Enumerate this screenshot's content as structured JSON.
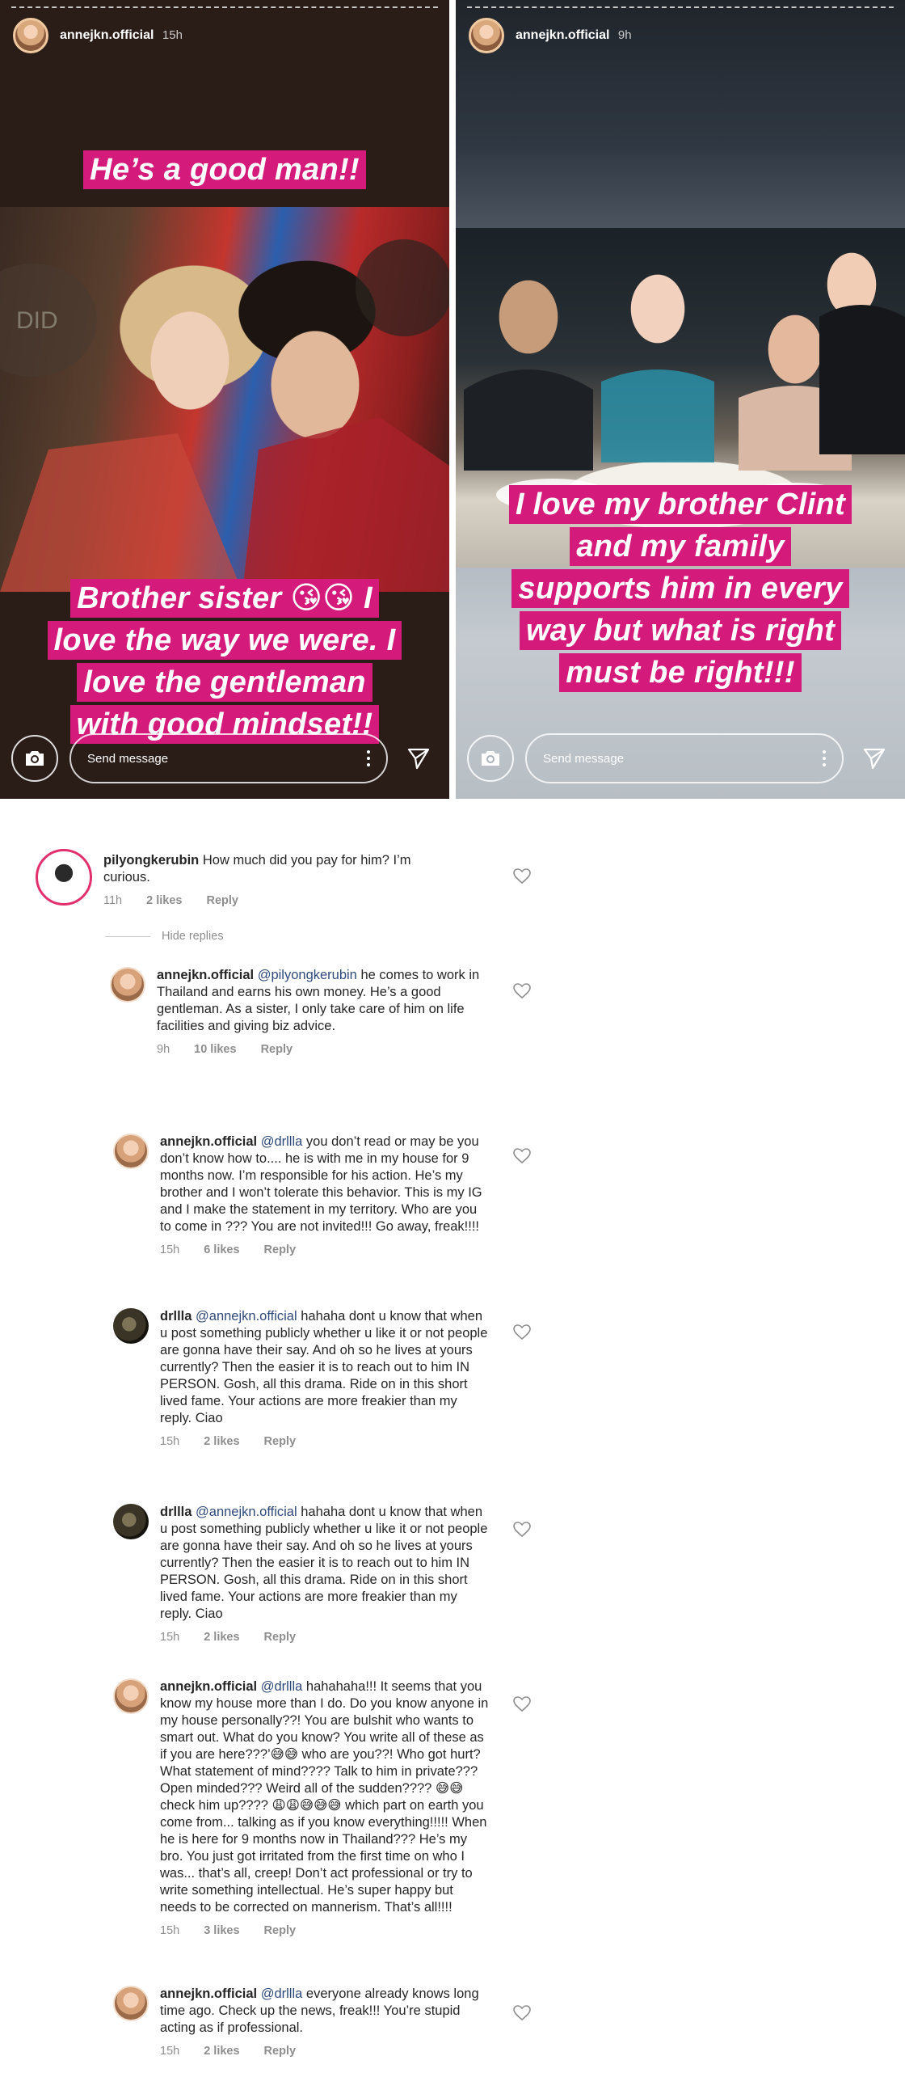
{
  "stories": [
    {
      "username": "annejkn.official",
      "time": "15h",
      "caption_top": [
        "He’s a good man!!"
      ],
      "caption_bottom": [
        "Brother sister 😘😘 I",
        "love the way we were. I",
        "love the gentleman",
        "with good mindset!!"
      ],
      "message_placeholder": "Send message"
    },
    {
      "username": "annejkn.official",
      "time": "9h",
      "caption_bottom": [
        "I love my brother Clint",
        "and my family",
        "supports him in every",
        "way but what is right",
        "must be right!!!"
      ],
      "message_placeholder": "Send message"
    }
  ],
  "comments": {
    "top": {
      "username": "pilyongkerubin",
      "text": "How much did you pay for him? I’m curious.",
      "time": "11h",
      "likes": "2 likes",
      "reply": "Reply"
    },
    "hide_replies": "Hide replies",
    "r1": {
      "username": "annejkn.official",
      "mention": "@pilyongkerubin",
      "text": "he comes to work in Thailand and earns his own money. He’s a good gentleman. As a sister, I only take care of him on life facilities and giving biz advice.",
      "time": "9h",
      "likes": "10 likes",
      "reply": "Reply"
    },
    "r2": {
      "username": "annejkn.official",
      "mention": "@drllla",
      "text": "you don’t read or may be you don’t know how to.... he is with me in my house for 9 months now. I’m responsible for his action. He’s my brother and I won’t tolerate this behavior. This is my IG and I make the statement in my territory. Who are you to come in ??? You are not invited!!! Go away, freak!!!!",
      "time": "15h",
      "likes": "6 likes",
      "reply": "Reply"
    },
    "r3": {
      "username": "drllla",
      "mention": "@annejkn.official",
      "text": "hahaha dont u know that when u post something publicly whether u like it or not people are gonna have their say. And oh so he lives at yours currently? Then the easier it is to reach out to him IN PERSON. Gosh, all this drama. Ride on in this short lived fame. Your actions are more freakier than my reply. Ciao",
      "time": "15h",
      "likes": "2 likes",
      "reply": "Reply"
    },
    "r4": {
      "username": "drllla",
      "mention": "@annejkn.official",
      "text": "hahaha dont u know that when u post something publicly whether u like it or not people are gonna have their say. And oh so he lives at yours currently? Then the easier it is to reach out to him IN PERSON. Gosh, all this drama. Ride on in this short lived fame. Your actions are more freakier than my reply. Ciao",
      "time": "15h",
      "likes": "2 likes",
      "reply": "Reply"
    },
    "r5": {
      "username": "annejkn.official",
      "mention": "@drllla",
      "text": "hahahaha!!! It seems that you know my house more than I do. Do you know anyone in my house personally??! You are bulshit who wants to smart out. What do you know? You write all of these as if you are here???’😅😅 who are you??! Who got hurt? What statement of mind???? Talk to him in private??? Open minded??? Weird all of the sudden???? 😅😅 check him up???? 😩😩😅😅😅 which part on earth you come from... talking as if you know everything!!!!! When he is here for 9 months now in Thailand??? He’s my bro. You just got irritated from the first time on who I was... that’s all, creep! Don’t act professional or try to write something intellectual. He’s super happy but needs to be corrected on mannerism. That’s all!!!!",
      "time": "15h",
      "likes": "3 likes",
      "reply": "Reply"
    },
    "r6": {
      "username": "annejkn.official",
      "mention": "@drllla",
      "text": "everyone already knows long time ago. Check up the news, freak!!! You’re stupid acting as if professional.",
      "time": "15h",
      "likes": "2 likes",
      "reply": "Reply"
    }
  },
  "colors": {
    "caption_bg": "#d41a7a",
    "mention": "#2f4a7a",
    "meta": "#8e8e8e",
    "story_ring": "#e1306c"
  },
  "icons": [
    "camera-icon",
    "more-vertical-icon",
    "send-icon",
    "heart-icon"
  ]
}
